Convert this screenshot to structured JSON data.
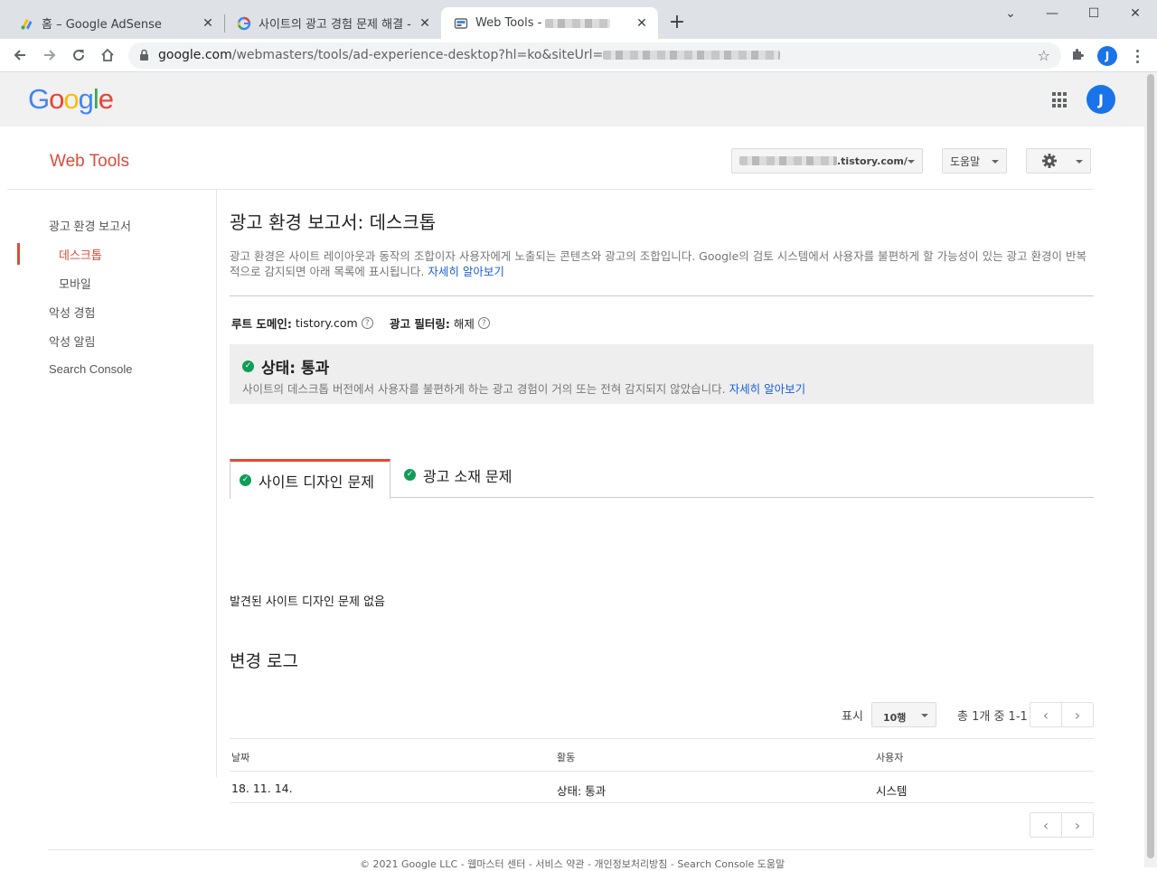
{
  "browser": {
    "tabs": [
      {
        "title": "홈 – Google AdSense"
      },
      {
        "title": "사이트의 광고 경험 문제 해결 -"
      },
      {
        "title": "Web Tools -"
      }
    ],
    "url_host": "google.com",
    "url_path": "/webmasters/tools/ad-experience-desktop?hl=ko&siteUrl=",
    "profile_initial": "J"
  },
  "header": {
    "logo_letters": [
      {
        "ch": "G",
        "color": "#4285F4"
      },
      {
        "ch": "o",
        "color": "#EA4335"
      },
      {
        "ch": "o",
        "color": "#FBBC05"
      },
      {
        "ch": "g",
        "color": "#4285F4"
      },
      {
        "ch": "l",
        "color": "#34A853"
      },
      {
        "ch": "e",
        "color": "#EA4335"
      }
    ],
    "avatar_initial": "J",
    "product_title": "Web Tools",
    "site_suffix": ".tistory.com/",
    "help_label": "도움말"
  },
  "sidebar": {
    "items": [
      {
        "label": "광고 환경 보고서"
      },
      {
        "label": "데스크톱"
      },
      {
        "label": "모바일"
      },
      {
        "label": "악성 경험"
      },
      {
        "label": "악성 알림"
      },
      {
        "label": "Search Console"
      }
    ]
  },
  "main": {
    "title": "광고 환경 보고서: 데스크톱",
    "description": "광고 환경은 사이트 레이아웃과 동작의 조합이자 사용자에게 노출되는 콘텐츠와 광고의 조합입니다. Google의 검토 시스템에서 사용자를 불편하게 할 가능성이 있는 광고 환경이 반복적으로 감지되면 아래 목록에 표시됩니다.",
    "learn_more": "자세히 알아보기",
    "root_domain_label": "루트 도메인:",
    "root_domain_value": "tistory.com",
    "ad_filter_label": "광고 필터링:",
    "ad_filter_value": "해제",
    "status_title": "상태: 통과",
    "status_desc": "사이트의 데스크톱 버전에서 사용자를 불편하게 하는 광고 경험이 거의 또는 전혀 감지되지 않았습니다.",
    "status_learn_more": "자세히 알아보기",
    "tabs": [
      {
        "label": "사이트 디자인 문제"
      },
      {
        "label": "광고 소재 문제"
      }
    ],
    "no_issue_text": "발견된 사이트 디자인 문제 없음",
    "changelog_title": "변경 로그",
    "show_label": "표시",
    "rows_value": "10행",
    "page_info": "총 1개 중 1-1",
    "table": {
      "headers": [
        "날짜",
        "활동",
        "사용자"
      ],
      "rows": [
        [
          "18. 11. 14.",
          "상태: 통과",
          "시스템"
        ]
      ]
    }
  },
  "footer": {
    "text": "© 2021 Google LLC - 웹마스터 센터 - 서비스 약관 - 개인정보처리방침 - Search Console 도움말"
  },
  "colors": {
    "accent_red": "#dd4b39",
    "link_blue": "#1a5ed8",
    "pass_green": "#0f9d58"
  }
}
